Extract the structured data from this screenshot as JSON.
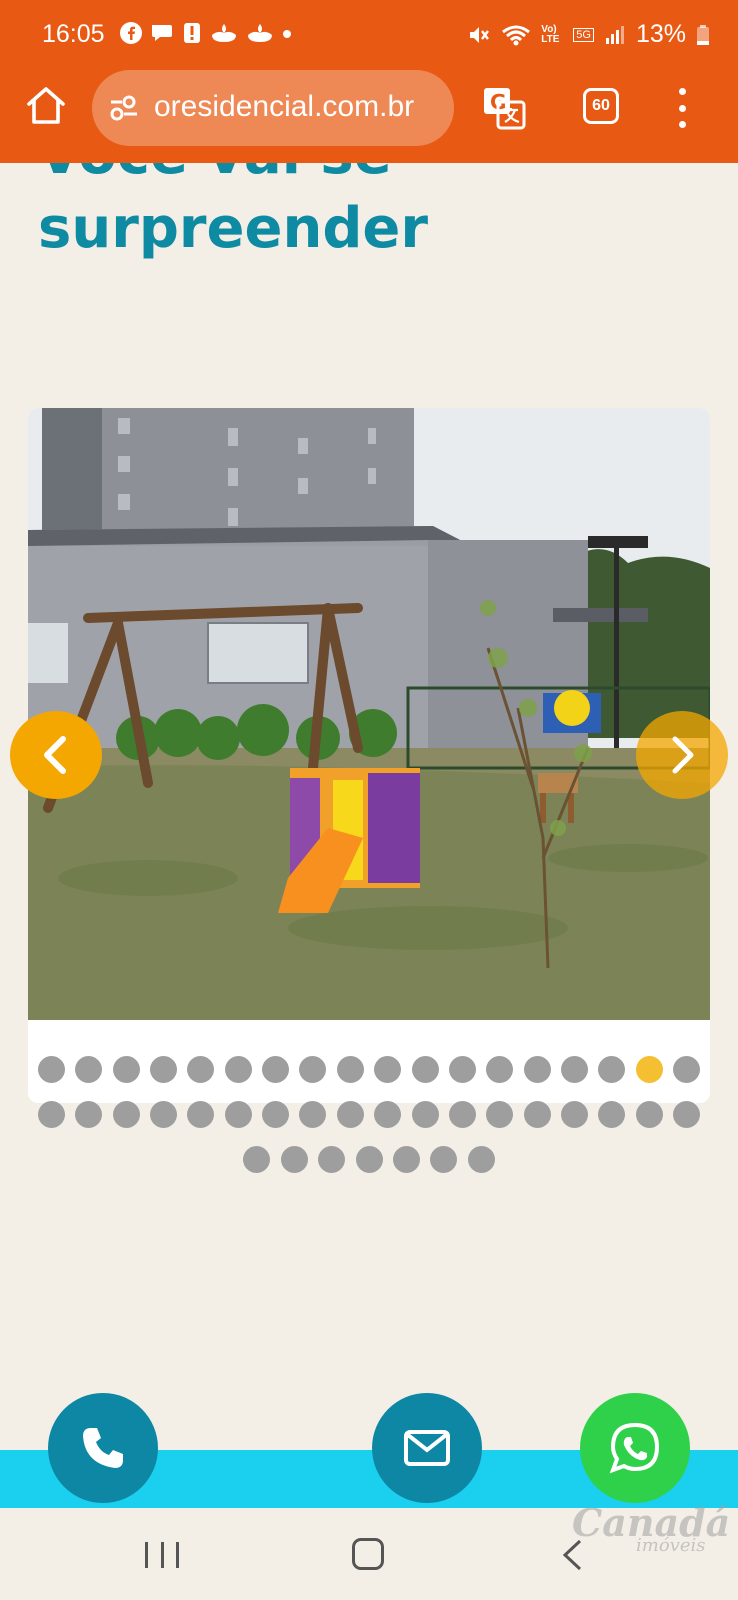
{
  "status_bar": {
    "time": "16:05",
    "battery_percent": "13%",
    "network": "5G",
    "volte": "Vo) LTE"
  },
  "browser": {
    "url": "oresidencial.com.br",
    "tabs_count": "60"
  },
  "page": {
    "heading_line1": "Você vai se",
    "heading_line2": "surpreender"
  },
  "carousel": {
    "total_slides": 43,
    "active_index": 16,
    "prev_icon": "chevron-left-icon",
    "next_icon": "chevron-right-icon"
  },
  "contact_buttons": {
    "phone_icon": "phone-icon",
    "email_icon": "mail-icon",
    "whatsapp_icon": "whatsapp-icon"
  },
  "watermark": {
    "brand": "Canadá",
    "sub": "imóveis"
  },
  "colors": {
    "chrome": "#e85a14",
    "heading": "#0e8ba3",
    "arrow": "#f4a700",
    "dot_active": "#f5bf32",
    "dot": "#9e9e9e",
    "cyan_bar": "#1bcfee",
    "whatsapp": "#2fd14a"
  }
}
